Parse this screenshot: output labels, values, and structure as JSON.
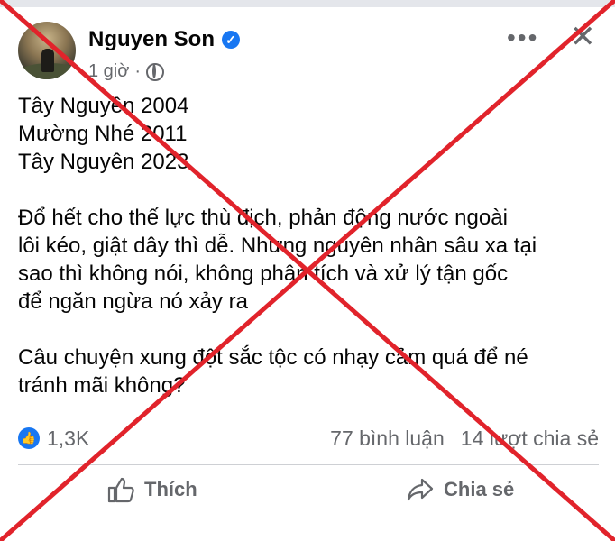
{
  "post": {
    "author": "Nguyen Son",
    "time": "1 giờ",
    "text_lines": [
      "Tây Nguyên 2004",
      "Mường Nhé 2011",
      "Tây Nguyên 2023",
      "",
      "Đổ hết cho thế lực thù địch, phản động nước ngoài",
      "lôi kéo, giật dây thì dễ. Nhưng nguyên nhân sâu xa tại",
      "sao thì không nói, không phân tích và xử lý tận gốc",
      "để ngăn ngừa nó xảy ra",
      "",
      "Câu chuyện xung đột sắc tộc có nhạy cảm quá để né",
      "tránh mãi không?"
    ]
  },
  "stats": {
    "reactions": "1,3K",
    "comments": "77 bình luận",
    "shares": "14 lượt chia sẻ"
  },
  "actions": {
    "like_label": "Thích",
    "share_label": "Chia sẻ"
  },
  "colors": {
    "brand_blue": "#1877f2",
    "muted": "#65676b",
    "cross_red": "#e1232b"
  },
  "icons": [
    "verified-badge-icon",
    "globe-icon",
    "more-icon",
    "close-icon",
    "like-reaction-icon",
    "thumbs-up-icon",
    "share-arrow-icon"
  ]
}
